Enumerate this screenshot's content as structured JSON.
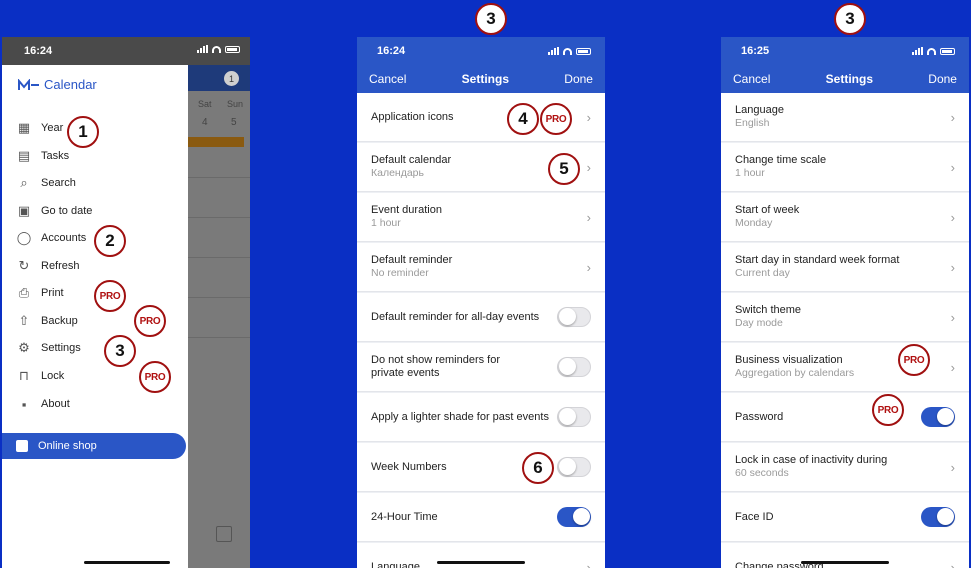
{
  "phone1": {
    "status_time": "16:24",
    "app_title": "Calendar",
    "menu": [
      {
        "icon": "calendar-year-icon",
        "label": "Year"
      },
      {
        "icon": "tasks-icon",
        "label": "Tasks"
      },
      {
        "icon": "search-icon",
        "label": "Search"
      },
      {
        "icon": "go-to-date-icon",
        "label": "Go to date"
      },
      {
        "icon": "person-icon",
        "label": "Accounts"
      },
      {
        "icon": "refresh-icon",
        "label": "Refresh"
      },
      {
        "icon": "printer-icon",
        "label": "Print"
      },
      {
        "icon": "backup-icon",
        "label": "Backup"
      },
      {
        "icon": "gear-icon",
        "label": "Settings"
      },
      {
        "icon": "lock-icon",
        "label": "Lock"
      },
      {
        "icon": "about-icon",
        "label": "About"
      }
    ],
    "shop": {
      "icon": "cart-icon",
      "label": "Online shop"
    },
    "bg_weekdays": [
      "Sat",
      "Sun"
    ],
    "bg_days": [
      "4",
      "5"
    ],
    "bg_badge": "1"
  },
  "phone2": {
    "status_time": "16:24",
    "nav": {
      "cancel": "Cancel",
      "title": "Settings",
      "done": "Done"
    },
    "rows": [
      {
        "label": "Application icons",
        "sub": "",
        "control": "chevron"
      },
      {
        "label": "Default calendar",
        "sub": "Календарь",
        "control": "chevron"
      },
      {
        "label": "Event duration",
        "sub": "1 hour",
        "control": "chevron"
      },
      {
        "label": "Default reminder",
        "sub": "No reminder",
        "control": "chevron"
      },
      {
        "label": "Default reminder for all-day events",
        "sub": "",
        "control": "toggle-off"
      },
      {
        "label": "Do not show reminders for private events",
        "sub": "",
        "control": "toggle-off"
      },
      {
        "label": "Apply a lighter shade for past events",
        "sub": "",
        "control": "toggle-off"
      },
      {
        "label": "Week Numbers",
        "sub": "",
        "control": "toggle-off"
      },
      {
        "label": "24-Hour Time",
        "sub": "",
        "control": "toggle-on"
      },
      {
        "label": "Language",
        "sub": "",
        "control": "chevron"
      }
    ]
  },
  "phone3": {
    "status_time": "16:25",
    "nav": {
      "cancel": "Cancel",
      "title": "Settings",
      "done": "Done"
    },
    "rows": [
      {
        "label": "Language",
        "sub": "English",
        "control": "chevron"
      },
      {
        "label": "Change time scale",
        "sub": "1 hour",
        "control": "chevron"
      },
      {
        "label": "Start of week",
        "sub": "Monday",
        "control": "chevron"
      },
      {
        "label": "Start day in standard week format",
        "sub": "Current day",
        "control": "chevron"
      },
      {
        "label": "Switch theme",
        "sub": "Day mode",
        "control": "chevron"
      },
      {
        "label": "Business visualization",
        "sub": "Aggregation by calendars",
        "control": "chevron"
      },
      {
        "label": "Password",
        "sub": "",
        "control": "toggle-on"
      },
      {
        "label": "Lock in case of inactivity during",
        "sub": "60 seconds",
        "control": "chevron"
      },
      {
        "label": "Face ID",
        "sub": "",
        "control": "toggle-on"
      },
      {
        "label": "Change password",
        "sub": "",
        "control": "chevron"
      }
    ]
  },
  "markers": {
    "n1": "1",
    "n2": "2",
    "n3": "3",
    "n4": "4",
    "n5": "5",
    "n6": "6",
    "pro": "PRO"
  },
  "colors": {
    "background": "#0a2fc4",
    "header_blue": "#2a56c6",
    "marker_red": "#a01010"
  }
}
